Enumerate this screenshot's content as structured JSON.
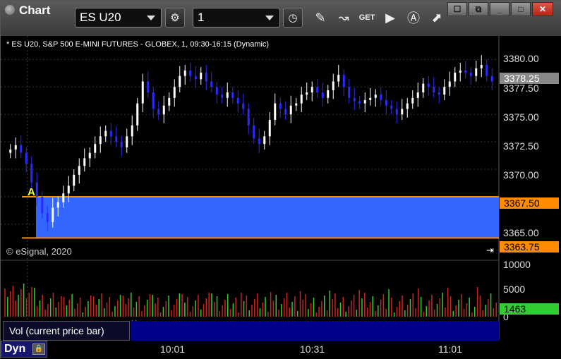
{
  "window": {
    "title": "Chart"
  },
  "toolbar": {
    "symbol": "ES U20",
    "interval": "1",
    "buttons": [
      "gear-icon",
      "clock-icon",
      "pen-icon",
      "studies-icon",
      "get-icon",
      "play-icon",
      "alert-icon",
      "link-icon"
    ]
  },
  "chart": {
    "info_line": "* ES U20, S&P 500 E-MINI FUTURES - GLOBEX, 1, 09:30-16:15 (Dynamic)",
    "copyright": "© eSignal, 2020",
    "marker_label": "A",
    "price_ticks": [
      "3380.00",
      "3377.50",
      "3375.00",
      "3372.50",
      "3370.00",
      "3365.00"
    ],
    "current_price": "3378.25",
    "zone_high": "3367.50",
    "zone_low": "3363.75",
    "colors": {
      "up": "#ffffff",
      "down": "#2a2aff",
      "zone": "#3366ff",
      "zone_line": "#ff8c00",
      "vol_up": "#33cc33",
      "vol_down": "#cc2222"
    }
  },
  "volume": {
    "legend": "Vol (current price bar)",
    "ticks": [
      "10000",
      "5000",
      "0"
    ],
    "current": "1463"
  },
  "xaxis": {
    "labels": [
      "10:01",
      "10:31",
      "11:01"
    ]
  },
  "status": {
    "mode": "Dyn"
  },
  "chart_data": {
    "type": "candlestick",
    "ylim": [
      3363.0,
      3381.5
    ],
    "series": [
      {
        "values": [
          3371.8,
          3372.2,
          3371.5,
          3370.5,
          3368.8,
          3367.5,
          3366.0,
          3365.2,
          3366.5,
          3367.0,
          3367.8,
          3368.5,
          3369.5,
          3370.3,
          3371.0,
          3371.5,
          3372.3,
          3373.0,
          3373.5,
          3373.0,
          3372.5,
          3372.0,
          3373.0,
          3374.0,
          3376.0,
          3378.0,
          3377.0,
          3375.5,
          3375.0,
          3375.8,
          3376.5,
          3377.5,
          3378.5,
          3379.0,
          3378.5,
          3378.2,
          3378.8,
          3378.0,
          3377.5,
          3376.8,
          3376.5,
          3377.0,
          3376.5,
          3376.0,
          3375.5,
          3374.0,
          3372.8,
          3372.3,
          3373.0,
          3374.5,
          3376.0,
          3375.5,
          3375.0,
          3375.8,
          3376.0,
          3376.8,
          3377.0,
          3377.5,
          3377.0,
          3376.5,
          3377.2,
          3378.0,
          3378.6,
          3377.5,
          3376.5,
          3376.2,
          3376.0,
          3376.3,
          3376.5,
          3376.8,
          3376.3,
          3375.8,
          3375.5,
          3375.0,
          3375.5,
          3376.0,
          3376.5,
          3377.0,
          3377.8,
          3377.5,
          3377.0,
          3376.8,
          3377.5,
          3378.0,
          3378.8,
          3379.0,
          3378.8,
          3378.5,
          3379.2,
          3379.5,
          3378.5,
          3378.0
        ]
      }
    ]
  }
}
